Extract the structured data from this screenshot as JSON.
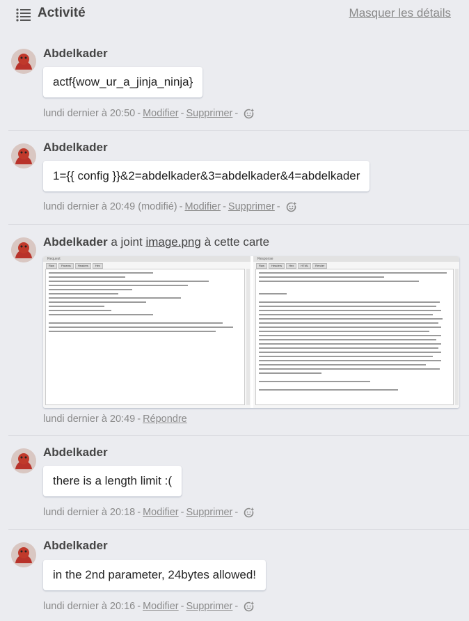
{
  "header": {
    "title": "Activité",
    "toggle_label": "Masquer les détails"
  },
  "separator": "-",
  "comments": [
    {
      "author": "Abdelkader",
      "text": "actf{wow_ur_a_jinja_ninja}",
      "timestamp": "lundi dernier à 20:50",
      "edit_label": "Modifier",
      "delete_label": "Supprimer",
      "reaction_icon": "add-reaction-icon"
    },
    {
      "author": "Abdelkader",
      "text": "1={{ config }}&2=abdelkader&3=abdelkader&4=abdelkader",
      "timestamp": "lundi dernier à 20:49 (modifié)",
      "edit_label": "Modifier",
      "delete_label": "Supprimer",
      "reaction_icon": "add-reaction-icon"
    },
    {
      "author": "Abdelkader",
      "text": "there is a length limit :(",
      "timestamp": "lundi dernier à 20:18",
      "edit_label": "Modifier",
      "delete_label": "Supprimer",
      "reaction_icon": "add-reaction-icon"
    },
    {
      "author": "Abdelkader",
      "text": "in the 2nd parameter, 24bytes allowed!",
      "timestamp": "lundi dernier à 20:16",
      "edit_label": "Modifier",
      "delete_label": "Supprimer",
      "reaction_icon": "add-reaction-icon"
    }
  ],
  "attachment_event": {
    "author": "Abdelkader",
    "action_prefix": "a joint",
    "file_name": "image.png",
    "action_suffix": "à cette carte",
    "timestamp": "lundi dernier à 20:49",
    "reply_label": "Répondre",
    "preview": {
      "left_title": "Request",
      "left_tabs": [
        "Raw",
        "Params",
        "Headers",
        "Hex"
      ],
      "right_title": "Response",
      "right_tabs": [
        "Raw",
        "Headers",
        "Hex",
        "HTML",
        "Render"
      ]
    }
  },
  "colors": {
    "background": "#ebecf0",
    "muted_text": "#8a8a8a",
    "avatar_red": "#c0392b"
  }
}
